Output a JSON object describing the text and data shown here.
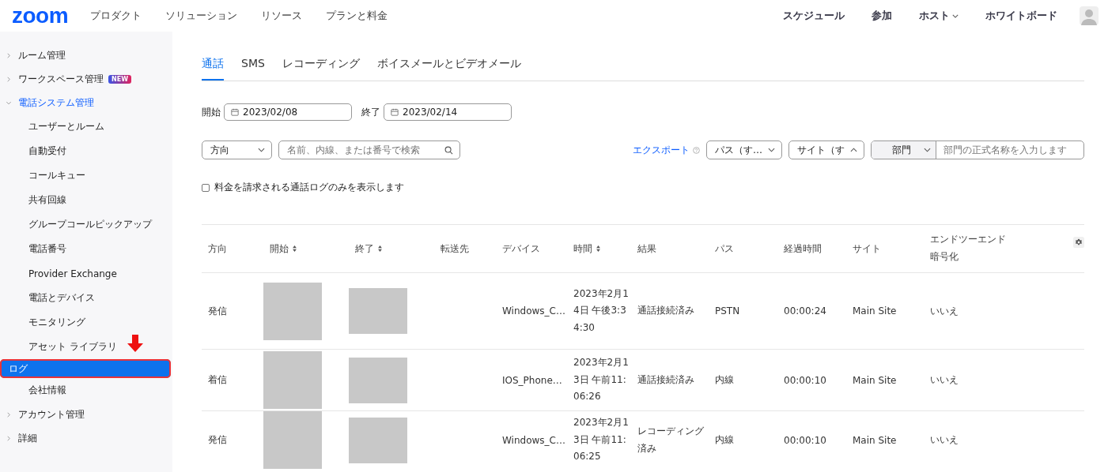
{
  "header": {
    "logo": "zoom",
    "nav": [
      "プロダクト",
      "ソリューション",
      "リソース",
      "プランと料金"
    ],
    "right_nav": [
      {
        "label": "スケジュール",
        "dropdown": false
      },
      {
        "label": "参加",
        "dropdown": false
      },
      {
        "label": "ホスト",
        "dropdown": true
      },
      {
        "label": "ホワイトボード",
        "dropdown": false
      }
    ]
  },
  "sidebar": {
    "items": [
      {
        "label": "ルーム管理",
        "expanded": false,
        "selected": false
      },
      {
        "label": "ワークスペース管理",
        "expanded": false,
        "selected": false,
        "badge": "NEW"
      },
      {
        "label": "電話システム管理",
        "expanded": true,
        "selected": false,
        "children": [
          {
            "label": "ユーザーとルーム",
            "selected": false
          },
          {
            "label": "自動受付",
            "selected": false
          },
          {
            "label": "コールキュー",
            "selected": false
          },
          {
            "label": "共有回線",
            "selected": false
          },
          {
            "label": "グループコールピックアップ",
            "selected": false
          },
          {
            "label": "電話番号",
            "selected": false
          },
          {
            "label": "Provider Exchange",
            "selected": false
          },
          {
            "label": "電話とデバイス",
            "selected": false
          },
          {
            "label": "モニタリング",
            "selected": false
          },
          {
            "label": "アセット ライブラリ",
            "selected": false
          },
          {
            "label": "ログ",
            "selected": true
          },
          {
            "label": "会社情報",
            "selected": false
          }
        ]
      },
      {
        "label": "アカウント管理",
        "expanded": false,
        "selected": false
      },
      {
        "label": "詳細",
        "expanded": false,
        "selected": false
      }
    ]
  },
  "tabs": [
    {
      "label": "通話",
      "selected": true
    },
    {
      "label": "SMS",
      "selected": false
    },
    {
      "label": "レコーディング",
      "selected": false
    },
    {
      "label": "ボイスメールとビデオメール",
      "selected": false
    }
  ],
  "date_range": {
    "start_label": "開始",
    "start": "2023/02/08",
    "end_label": "終了",
    "end": "2023/02/14"
  },
  "filters": {
    "direction": "方向",
    "search_placeholder": "名前、内線、または番号で検索",
    "export": "エクスポート",
    "path": "パス（す…",
    "site": "サイト（す",
    "department": "部門",
    "department_placeholder": "部門の正式名称を入力します"
  },
  "billed_only": {
    "label": "料金を請求される通話ログのみを表示します",
    "checked": false
  },
  "table": {
    "columns": [
      {
        "label": "方向",
        "sortable": false
      },
      {
        "label": "開始",
        "sortable": true
      },
      {
        "label": "終了",
        "sortable": true
      },
      {
        "label": "転送先",
        "sortable": false
      },
      {
        "label": "デバイス",
        "sortable": false
      },
      {
        "label": "時間",
        "sortable": true
      },
      {
        "label": "結果",
        "sortable": false
      },
      {
        "label": "パス",
        "sortable": false
      },
      {
        "label": "経過時間",
        "sortable": false
      },
      {
        "label": "サイト",
        "sortable": false
      },
      {
        "label": "エンドツーエンド暗号化",
        "sortable": false
      }
    ],
    "rows": [
      {
        "direction": "発信",
        "device": "Windows_C…",
        "time": "2023年2月14日 午後3:34:30",
        "result": "通話接続済み",
        "path": "PSTN",
        "duration": "00:00:24",
        "site": "Main Site",
        "e2e": "いいえ"
      },
      {
        "direction": "着信",
        "device": "IOS_Phone…",
        "time": "2023年2月13日 午前11:06:26",
        "result": "通話接続済み",
        "path": "内線",
        "duration": "00:00:10",
        "site": "Main Site",
        "e2e": "いいえ"
      },
      {
        "direction": "発信",
        "device": "Windows_C…",
        "time": "2023年2月13日 午前11:06:25",
        "result": "レコーディング済み",
        "path": "内線",
        "duration": "00:00:10",
        "site": "Main Site",
        "e2e": "いいえ"
      }
    ]
  }
}
